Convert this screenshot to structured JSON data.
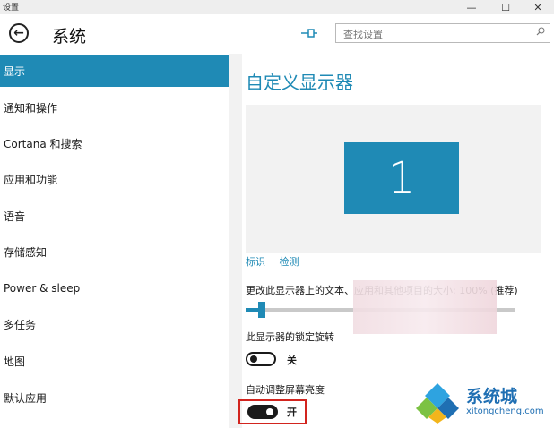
{
  "window": {
    "title": "设置",
    "minimize_icon": "minimize-icon",
    "maximize_icon": "maximize-icon",
    "close_icon": "close-icon"
  },
  "header": {
    "back_icon": "back-arrow-icon",
    "title": "系统",
    "pin_icon": "pin-icon",
    "search_placeholder": "查找设置",
    "search_icon": "search-icon"
  },
  "sidebar": {
    "items": [
      {
        "label": "显示",
        "selected": true
      },
      {
        "label": "通知和操作"
      },
      {
        "label": "Cortana 和搜索"
      },
      {
        "label": "应用和功能"
      },
      {
        "label": "语音"
      },
      {
        "label": "存储感知"
      },
      {
        "label": "Power & sleep"
      },
      {
        "label": "多任务"
      },
      {
        "label": "地图"
      },
      {
        "label": "默认应用"
      }
    ]
  },
  "main": {
    "title": "自定义显示器",
    "monitor_number": "1",
    "link_identify": "标识",
    "link_detect": "检测",
    "scale_label": "更改此显示器上的文本、应用和其他项目的大小: 100% (推荐)",
    "scale_value_fraction": 0.0,
    "rotation_lock_label": "此显示器的锁定旋转",
    "rotation_lock_state": "关",
    "auto_brightness_label": "自动调整屏幕亮度",
    "auto_brightness_state": "开"
  },
  "watermark": {
    "text": "系统城",
    "url": "xitongcheng.com"
  },
  "colors": {
    "accent": "#1f8ab5",
    "highlight": "#d2241e"
  }
}
